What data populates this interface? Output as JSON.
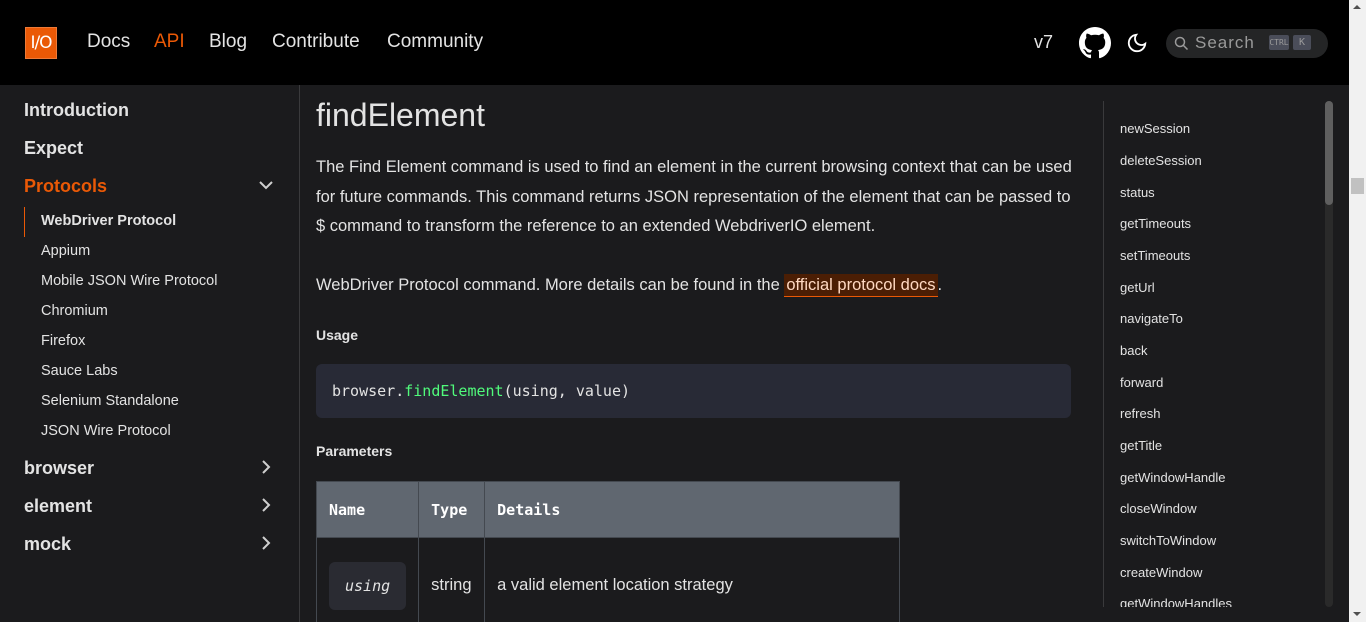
{
  "navbar": {
    "logo_text": "I/O",
    "links": [
      "Docs",
      "API",
      "Blog",
      "Contribute",
      "Community"
    ],
    "active_link": "API",
    "version": "v7",
    "search_placeholder": "Search",
    "search_keys": [
      "CTRL",
      "K"
    ],
    "accent_color": "#ea5906"
  },
  "sidebar": {
    "top_items": [
      "Introduction",
      "Expect",
      "Protocols",
      "browser",
      "element",
      "mock"
    ],
    "active_top": "Protocols",
    "sub_items": [
      "WebDriver Protocol",
      "Appium",
      "Mobile JSON Wire Protocol",
      "Chromium",
      "Firefox",
      "Sauce Labs",
      "Selenium Standalone",
      "JSON Wire Protocol"
    ],
    "active_sub": "WebDriver Protocol"
  },
  "main": {
    "title": "findElement",
    "description": "The Find Element command is used to find an element in the current browsing context that can be used for future commands. This command returns JSON representation of the element that can be passed to $ command to transform the reference to an extended WebdriverIO element.",
    "note_prefix": "WebDriver Protocol command. More details can be found in the ",
    "note_link": "official protocol docs",
    "note_suffix": ".",
    "usage_heading": "Usage",
    "code_prefix": "browser.",
    "code_fn": "findElement",
    "code_args": "(using, value)",
    "params_heading": "Parameters",
    "table_headers": [
      "Name",
      "Type",
      "Details"
    ],
    "table_rows": [
      {
        "name": "using",
        "type": "string",
        "details": "a valid element location strategy"
      }
    ]
  },
  "toc": {
    "items": [
      "newSession",
      "deleteSession",
      "status",
      "getTimeouts",
      "setTimeouts",
      "getUrl",
      "navigateTo",
      "back",
      "forward",
      "refresh",
      "getTitle",
      "getWindowHandle",
      "closeWindow",
      "switchToWindow",
      "createWindow",
      "getWindowHandles"
    ]
  }
}
